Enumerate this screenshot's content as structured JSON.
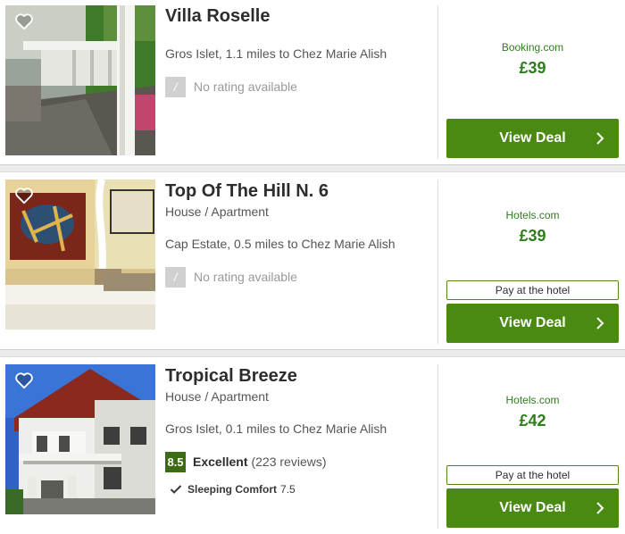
{
  "listings": [
    {
      "name": "Villa Roselle",
      "type": "",
      "location": "Gros Islet, 1.1 miles to Chez Marie Alish",
      "rating_icon": "/",
      "rating_text": "No rating available",
      "provider": "Booking.com",
      "price": "£39",
      "pay_label": "",
      "deal_label": "View Deal"
    },
    {
      "name": "Top Of The Hill N. 6",
      "type": "House / Apartment",
      "location": "Cap Estate, 0.5 miles to Chez Marie Alish",
      "rating_icon": "/",
      "rating_text": "No rating available",
      "provider": "Hotels.com",
      "price": "£39",
      "pay_label": "Pay at the hotel",
      "deal_label": "View Deal"
    },
    {
      "name": "Tropical Breeze",
      "type": "House / Apartment",
      "location": "Gros Islet, 0.1 miles to Chez Marie Alish",
      "score": "8.5",
      "score_word": "Excellent",
      "score_count": "(223 reviews)",
      "sub_rating_label": "Sleeping Comfort",
      "sub_rating_value": "7.5",
      "provider": "Hotels.com",
      "price": "£42",
      "pay_label": "Pay at the hotel",
      "deal_label": "View Deal"
    }
  ],
  "colors": {
    "deal_button": "#4b8a12",
    "price": "#2f7d1c",
    "score_badge": "#3d6b16"
  },
  "icons": {
    "favorite": "heart-outline-icon",
    "chevron": "chevron-right-icon",
    "check": "checkmark-icon"
  }
}
